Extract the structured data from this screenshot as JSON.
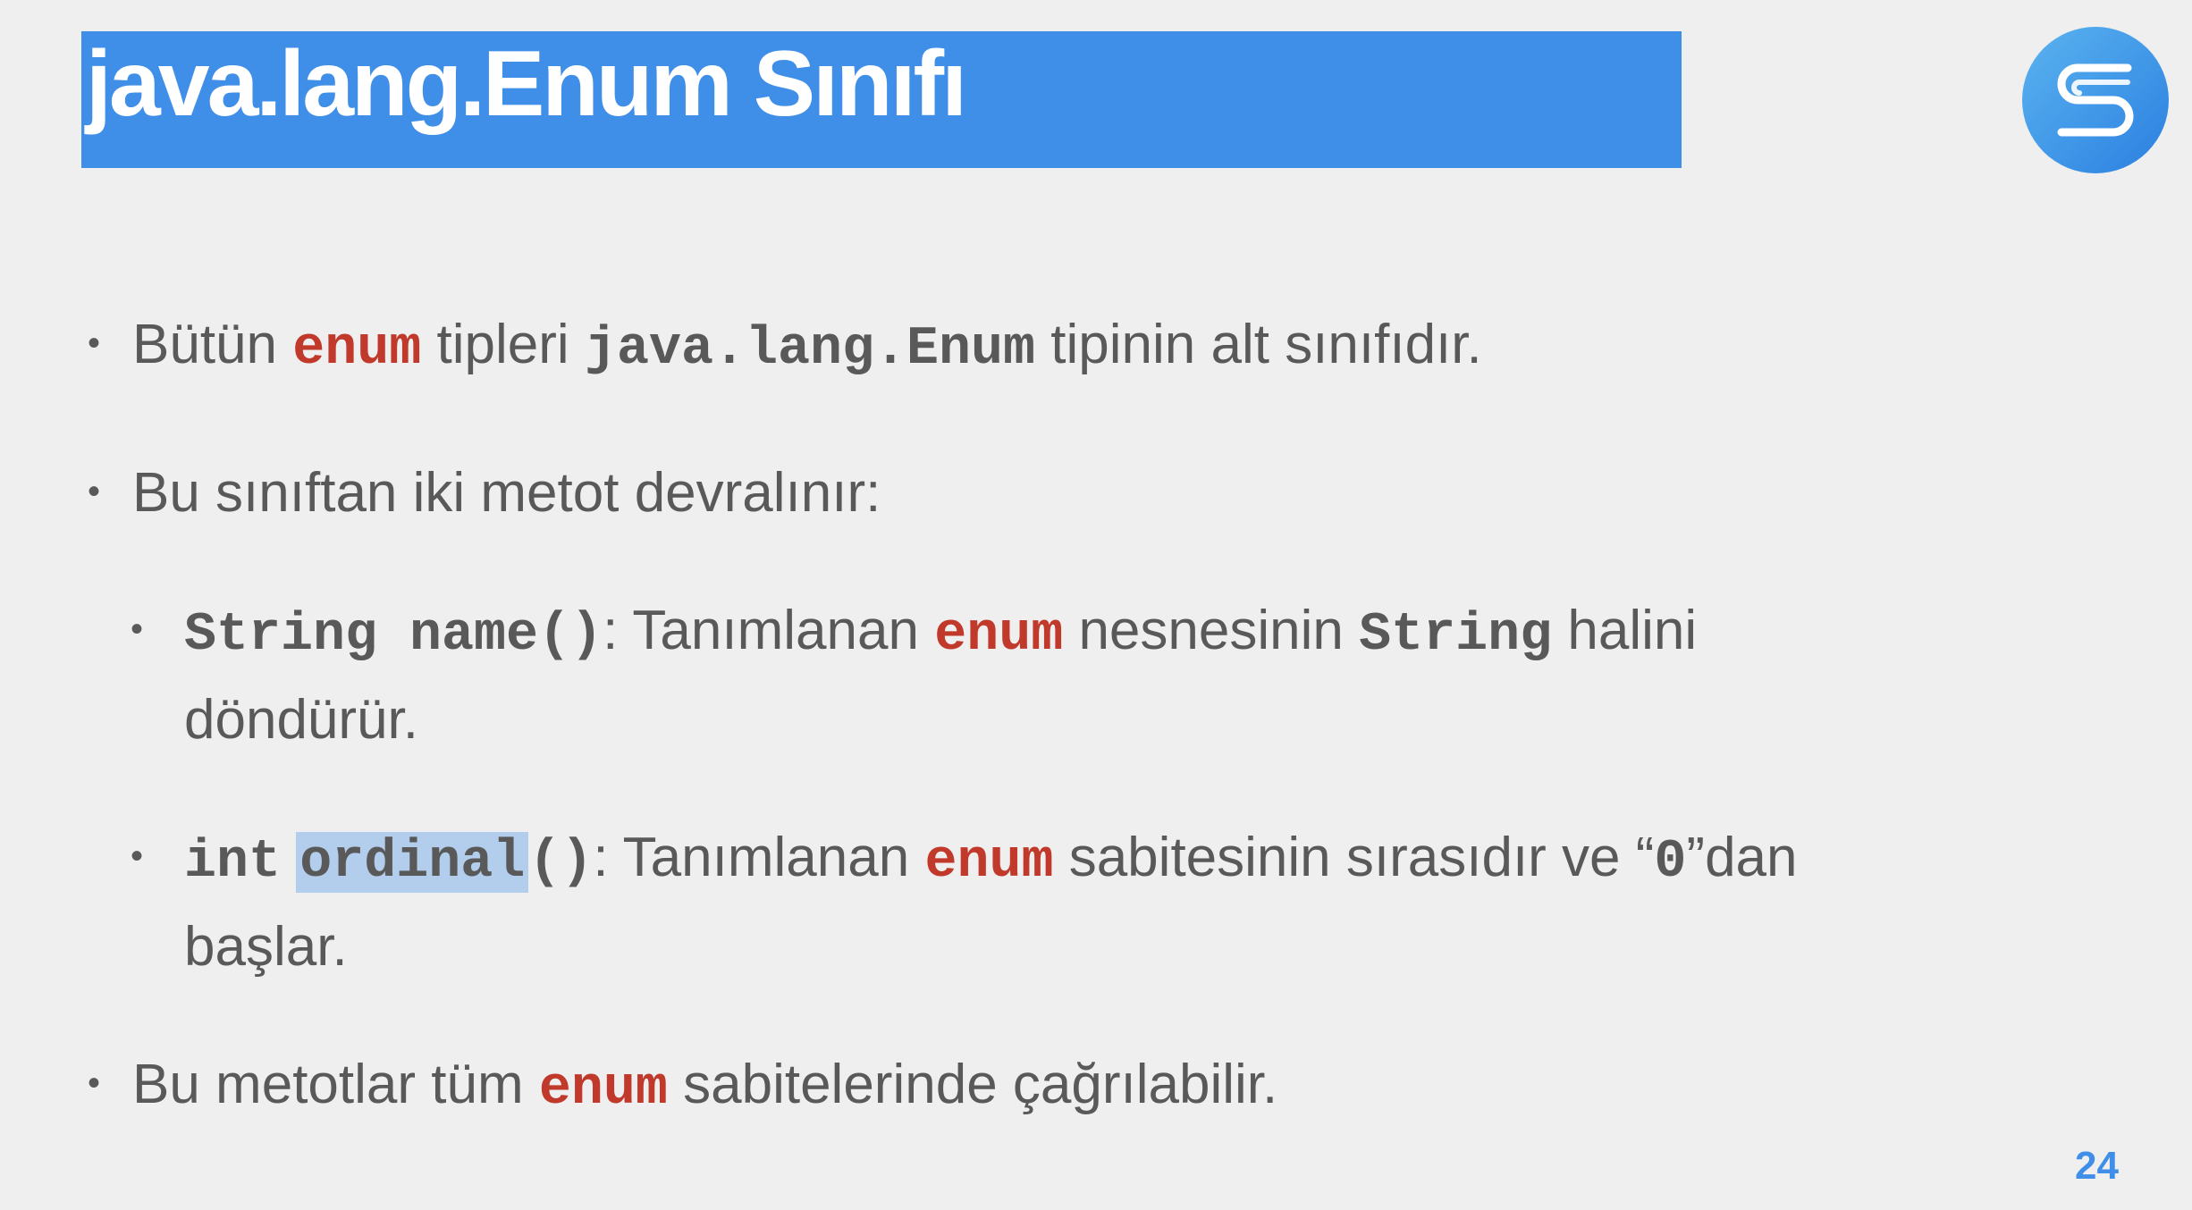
{
  "slide": {
    "title": "java.lang.Enum Sınıfı",
    "page_number": "24",
    "brand_color": "#3f8ee8",
    "keyword_color": "#c0392b",
    "highlight_color": "#b3cdec"
  },
  "bullets": {
    "b1": {
      "t1": "Bütün",
      "kw1": "enum",
      "t2": "tipleri",
      "code1": "java.lang.Enum",
      "t3": "tipinin alt sınıfıdır."
    },
    "b2": {
      "t1": "Bu sınıftan iki metot devralınır:"
    },
    "b3": {
      "code1": "String name()",
      "t1": ": Tanımlanan",
      "kw1": "enum",
      "t2": "nesnesinin",
      "code2": "String",
      "t3": "halini",
      "t4": "döndürür."
    },
    "b4": {
      "code1": "int",
      "code_hl": "ordinal",
      "code2": "()",
      "t1": ": Tanımlanan",
      "kw1": "enum",
      "t2": "sabitesinin sırasıdır ve “",
      "code3": "0",
      "t3": "”dan",
      "t4": "başlar."
    },
    "b5": {
      "t1": "Bu metotlar tüm",
      "kw1": "enum",
      "t2": "sabitelerinde çağrılabilir."
    }
  },
  "icons": {
    "logo": "brand-s-logo-icon",
    "bullet": "bullet-dot-icon"
  }
}
